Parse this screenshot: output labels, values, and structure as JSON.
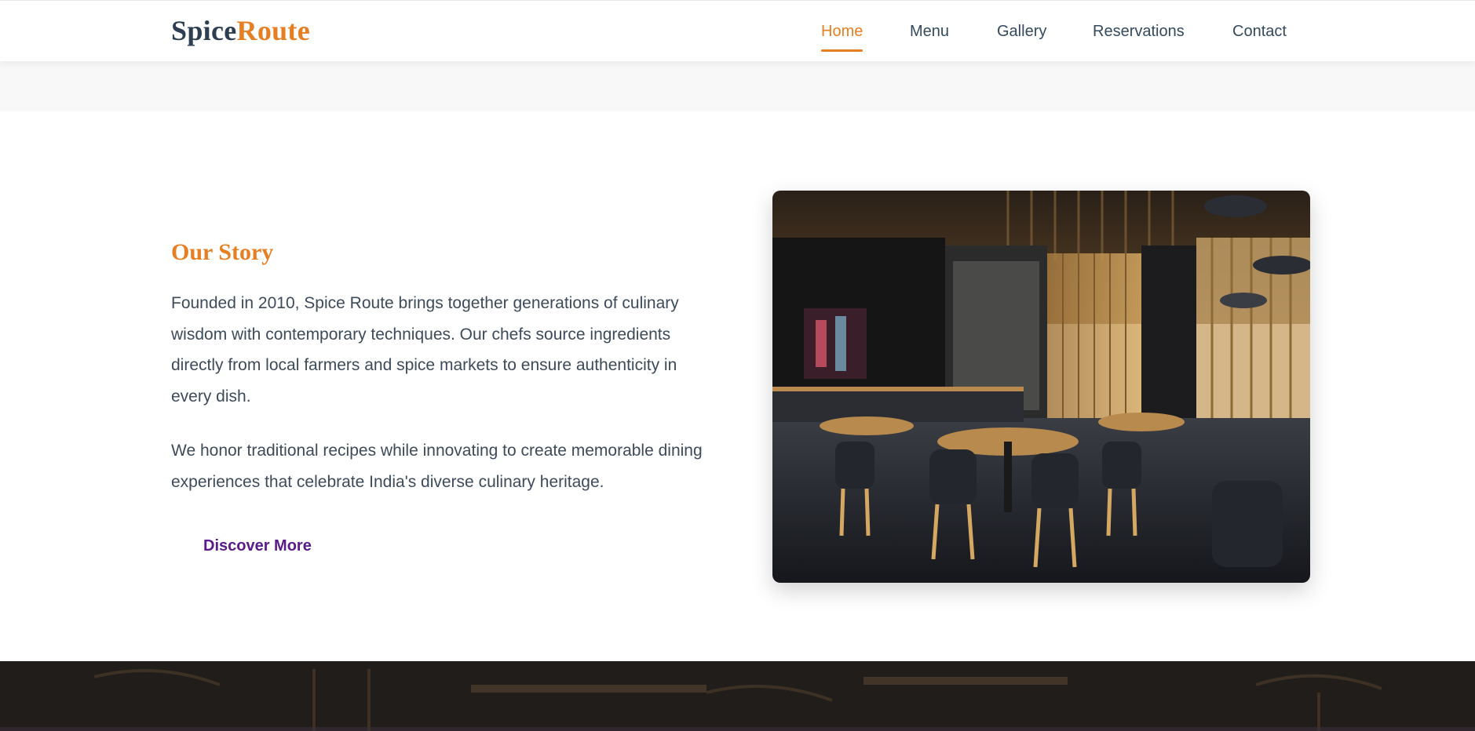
{
  "brand": {
    "part1": "Spice",
    "part2": "Route"
  },
  "nav": {
    "items": [
      {
        "label": "Home",
        "active": true
      },
      {
        "label": "Menu",
        "active": false
      },
      {
        "label": "Gallery",
        "active": false
      },
      {
        "label": "Reservations",
        "active": false
      },
      {
        "label": "Contact",
        "active": false
      }
    ]
  },
  "story": {
    "heading": "Our Story",
    "paragraph1": "Founded in 2010, Spice Route brings together generations of culinary wisdom with contemporary techniques. Our chefs source ingredients directly from local farmers and spice markets to ensure authenticity in every dish.",
    "paragraph2": "We honor traditional recipes while innovating to create memorable dining experiences that celebrate India's diverse culinary heritage.",
    "button_label": "Discover More",
    "image_subject": "restaurant-interior-photo"
  },
  "colors": {
    "accent": "#e67e22",
    "text": "#2c3e50",
    "button_text": "#5b1a8a",
    "band": "#f8f8f8"
  }
}
